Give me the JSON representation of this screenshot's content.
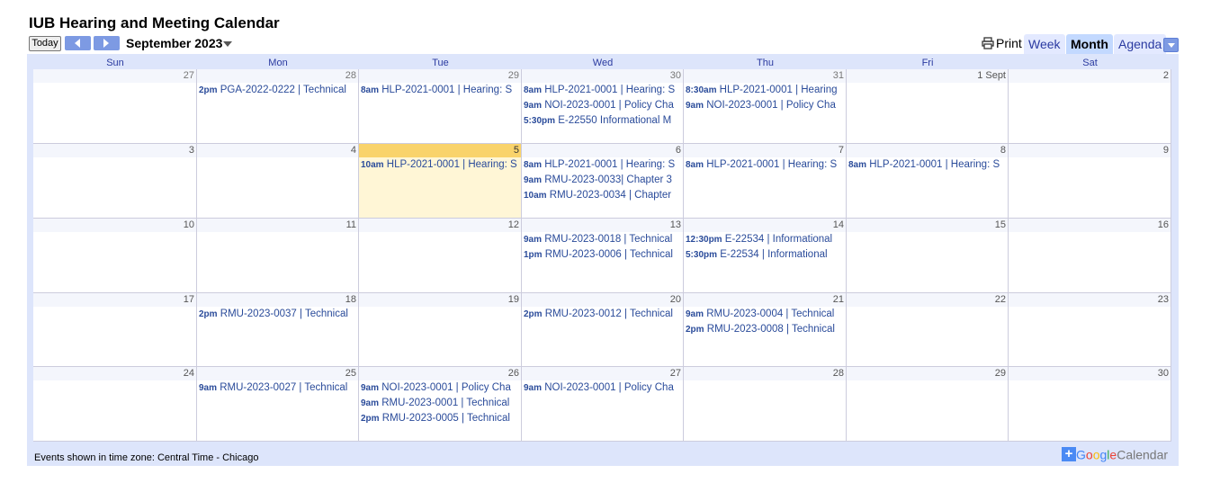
{
  "title": "IUB Hearing and Meeting Calendar",
  "toolbar": {
    "today": "Today",
    "current": "September 2023",
    "print": "Print",
    "tabs": [
      "Week",
      "Month",
      "Agenda"
    ]
  },
  "days": [
    "Sun",
    "Mon",
    "Tue",
    "Wed",
    "Thu",
    "Fri",
    "Sat"
  ],
  "weeks": [
    [
      {
        "d": "27",
        "o": true,
        "ev": []
      },
      {
        "d": "28",
        "o": true,
        "ev": [
          {
            "t": "2pm",
            "s": "PGA-2022-0222 | Technical"
          }
        ]
      },
      {
        "d": "29",
        "o": true,
        "ev": [
          {
            "t": "8am",
            "s": "HLP-2021-0001 | Hearing: S"
          }
        ]
      },
      {
        "d": "30",
        "o": true,
        "ev": [
          {
            "t": "8am",
            "s": "HLP-2021-0001 | Hearing: S"
          },
          {
            "t": "9am",
            "s": "NOI-2023-0001 | Policy Cha"
          },
          {
            "t": "5:30pm",
            "s": "E-22550 Informational M"
          }
        ]
      },
      {
        "d": "31",
        "o": true,
        "ev": [
          {
            "t": "8:30am",
            "s": "HLP-2021-0001 | Hearing"
          },
          {
            "t": "9am",
            "s": "NOI-2023-0001 | Policy Cha"
          }
        ]
      },
      {
        "d": "1 Sept",
        "o": false,
        "ev": []
      },
      {
        "d": "2",
        "o": false,
        "ev": []
      }
    ],
    [
      {
        "d": "3",
        "ev": []
      },
      {
        "d": "4",
        "ev": []
      },
      {
        "d": "5",
        "today": true,
        "ev": [
          {
            "t": "10am",
            "s": "HLP-2021-0001 | Hearing: S"
          }
        ]
      },
      {
        "d": "6",
        "ev": [
          {
            "t": "8am",
            "s": "HLP-2021-0001 | Hearing: S"
          },
          {
            "t": "9am",
            "s": "RMU-2023-0033| Chapter 3"
          },
          {
            "t": "10am",
            "s": "RMU-2023-0034 | Chapter"
          }
        ]
      },
      {
        "d": "7",
        "ev": [
          {
            "t": "8am",
            "s": "HLP-2021-0001 | Hearing: S"
          }
        ]
      },
      {
        "d": "8",
        "ev": [
          {
            "t": "8am",
            "s": "HLP-2021-0001 | Hearing: S"
          }
        ]
      },
      {
        "d": "9",
        "ev": []
      }
    ],
    [
      {
        "d": "10",
        "ev": []
      },
      {
        "d": "11",
        "ev": []
      },
      {
        "d": "12",
        "ev": []
      },
      {
        "d": "13",
        "ev": [
          {
            "t": "9am",
            "s": "RMU-2023-0018 | Technical"
          },
          {
            "t": "1pm",
            "s": "RMU-2023-0006 | Technical"
          }
        ]
      },
      {
        "d": "14",
        "ev": [
          {
            "t": "12:30pm",
            "s": "E-22534 | Informational"
          },
          {
            "t": "5:30pm",
            "s": "E-22534 | Informational"
          }
        ]
      },
      {
        "d": "15",
        "ev": []
      },
      {
        "d": "16",
        "ev": []
      }
    ],
    [
      {
        "d": "17",
        "ev": []
      },
      {
        "d": "18",
        "ev": [
          {
            "t": "2pm",
            "s": "RMU-2023-0037 | Technical"
          }
        ]
      },
      {
        "d": "19",
        "ev": []
      },
      {
        "d": "20",
        "ev": [
          {
            "t": "2pm",
            "s": "RMU-2023-0012 | Technical"
          }
        ]
      },
      {
        "d": "21",
        "ev": [
          {
            "t": "9am",
            "s": "RMU-2023-0004 | Technical"
          },
          {
            "t": "2pm",
            "s": "RMU-2023-0008 | Technical"
          }
        ]
      },
      {
        "d": "22",
        "ev": []
      },
      {
        "d": "23",
        "ev": []
      }
    ],
    [
      {
        "d": "24",
        "ev": []
      },
      {
        "d": "25",
        "ev": [
          {
            "t": "9am",
            "s": "RMU-2023-0027 | Technical"
          }
        ]
      },
      {
        "d": "26",
        "ev": [
          {
            "t": "9am",
            "s": "NOI-2023-0001 | Policy Cha"
          },
          {
            "t": "9am",
            "s": "RMU-2023-0001 | Technical"
          },
          {
            "t": "2pm",
            "s": "RMU-2023-0005 | Technical"
          }
        ]
      },
      {
        "d": "27",
        "ev": [
          {
            "t": "9am",
            "s": "NOI-2023-0001 | Policy Cha"
          }
        ]
      },
      {
        "d": "28",
        "ev": []
      },
      {
        "d": "29",
        "ev": []
      },
      {
        "d": "30",
        "ev": []
      }
    ]
  ],
  "footer": {
    "timezone": "Events shown in time zone: Central Time - Chicago",
    "google_word": "Google",
    "calendar_word": "Calendar"
  },
  "colors": {
    "accent": "#7d9ae3",
    "today": "#f9d36b",
    "frame": "#dde5fb",
    "event_text": "#2a4b9a"
  },
  "icons": {
    "prev": "chevron-left-icon",
    "next": "chevron-right-icon",
    "print": "printer-icon",
    "add": "plus-icon"
  }
}
